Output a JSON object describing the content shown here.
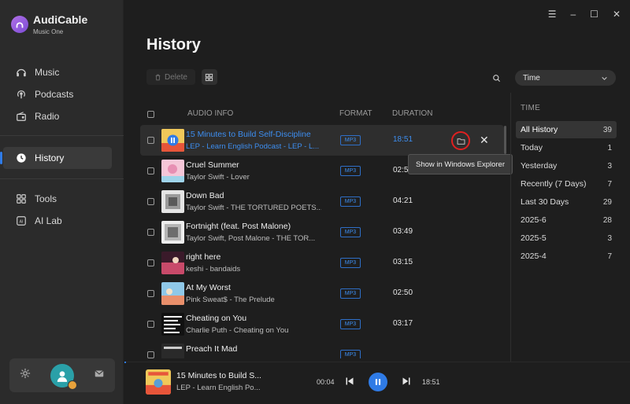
{
  "app": {
    "name": "AudiCable",
    "subtitle": "Music One"
  },
  "sidebar": {
    "items": [
      {
        "label": "Music",
        "icon": "headphones-icon"
      },
      {
        "label": "Podcasts",
        "icon": "podcast-icon"
      },
      {
        "label": "Radio",
        "icon": "radio-icon"
      },
      {
        "label": "History",
        "icon": "clock-icon",
        "active": true
      },
      {
        "label": "Tools",
        "icon": "tools-icon"
      },
      {
        "label": "AI Lab",
        "icon": "ai-icon"
      }
    ]
  },
  "window_controls": {
    "menu": "☰",
    "minimize": "–",
    "maximize": "☐",
    "close": "✕"
  },
  "page": {
    "title": "History"
  },
  "toolbar": {
    "delete_label": "Delete",
    "sort_value": "Time"
  },
  "table": {
    "headers": {
      "info": "AUDIO INFO",
      "format": "FORMAT",
      "duration": "DURATION"
    },
    "rows": [
      {
        "title": "15 Minutes to Build Self-Discipline",
        "subtitle": "LEP - Learn English Podcast - LEP - L...",
        "format": "MP3",
        "duration": "18:51",
        "active": true,
        "cover": "#e9b84a"
      },
      {
        "title": "Cruel Summer",
        "subtitle": "Taylor Swift - Lover",
        "format": "MP3",
        "duration": "02:58",
        "cover": "#f2a7c3"
      },
      {
        "title": "Down Bad",
        "subtitle": "Taylor Swift - THE TORTURED POETS...",
        "format": "MP3",
        "duration": "04:21",
        "cover": "#cfcfcf"
      },
      {
        "title": "Fortnight (feat. Post Malone)",
        "subtitle": "Taylor Swift, Post Malone - THE TOR...",
        "format": "MP3",
        "duration": "03:49",
        "cover": "#d8d8d8"
      },
      {
        "title": "right here",
        "subtitle": "keshi - bandaids",
        "format": "MP3",
        "duration": "03:15",
        "cover": "#c84a6a"
      },
      {
        "title": "At My Worst",
        "subtitle": "Pink Sweat$ - The Prelude",
        "format": "MP3",
        "duration": "02:50",
        "cover": "#e98f6b"
      },
      {
        "title": "Cheating on You",
        "subtitle": "Charlie Puth - Cheating on You",
        "format": "MP3",
        "duration": "03:17",
        "cover": "#1a1a1a"
      },
      {
        "title": "Preach It Mad",
        "subtitle": "",
        "format": "MP3",
        "duration": "",
        "cover": "#2a2a2a"
      }
    ]
  },
  "tooltip": {
    "text": "Show in Windows Explorer"
  },
  "filters": {
    "title": "TIME",
    "items": [
      {
        "label": "All History",
        "count": "39",
        "active": true
      },
      {
        "label": "Today",
        "count": "1"
      },
      {
        "label": "Yesterday",
        "count": "3"
      },
      {
        "label": "Recently (7 Days)",
        "count": "7"
      },
      {
        "label": "Last 30 Days",
        "count": "29"
      },
      {
        "label": "2025-6",
        "count": "28"
      },
      {
        "label": "2025-5",
        "count": "3"
      },
      {
        "label": "2025-4",
        "count": "7"
      }
    ]
  },
  "player": {
    "title": "15 Minutes to Build S...",
    "subtitle": "LEP - Learn English Po...",
    "current_time": "00:04",
    "total_time": "18:51"
  },
  "colors": {
    "accent": "#2f7be6",
    "highlight_ring": "#e02020",
    "background": "#1e1e1e",
    "sidebar": "#2b2b2b"
  }
}
